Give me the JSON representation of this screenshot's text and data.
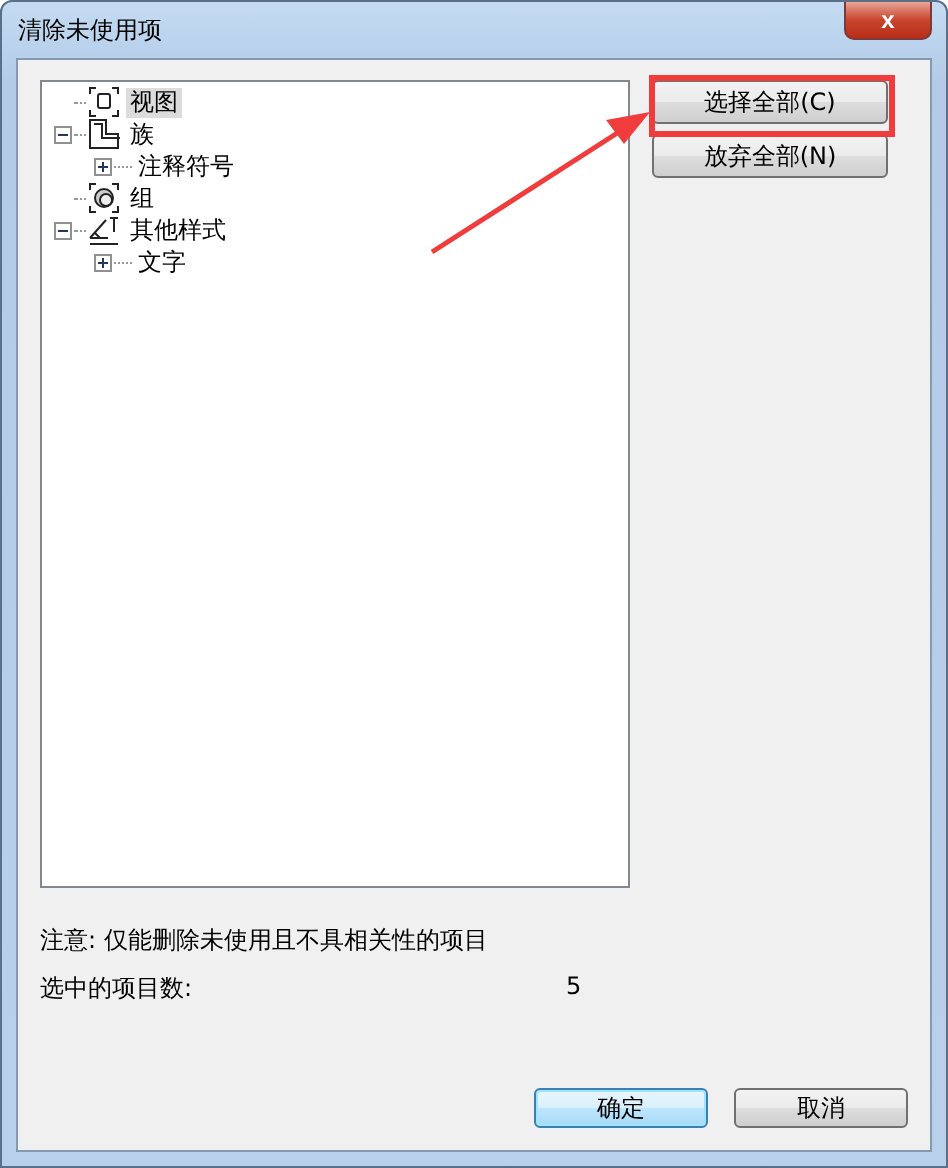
{
  "window": {
    "title": "清除未使用项",
    "close": "x"
  },
  "tree": [
    {
      "label": "视图",
      "kind": "view",
      "selected": true
    },
    {
      "label": "族",
      "kind": "family",
      "selected": false,
      "expanded": true,
      "children": [
        {
          "label": "注释符号",
          "kind": "category",
          "selected": false,
          "expanded": false
        }
      ]
    },
    {
      "label": "组",
      "kind": "group",
      "selected": false
    },
    {
      "label": "其他样式",
      "kind": "style",
      "selected": false,
      "expanded": true,
      "children": [
        {
          "label": "文字",
          "kind": "category",
          "selected": false,
          "expanded": false
        }
      ]
    }
  ],
  "side_buttons": [
    "选择全部(C)",
    "放弃全部(N)"
  ],
  "note": "注意: 仅能删除未使用且不具相关性的项目",
  "selected_count": {
    "label": "选中的项目数:",
    "value": "5"
  },
  "buttons": [
    {
      "label": "确定",
      "default": true
    },
    {
      "label": "取消",
      "default": false
    }
  ]
}
